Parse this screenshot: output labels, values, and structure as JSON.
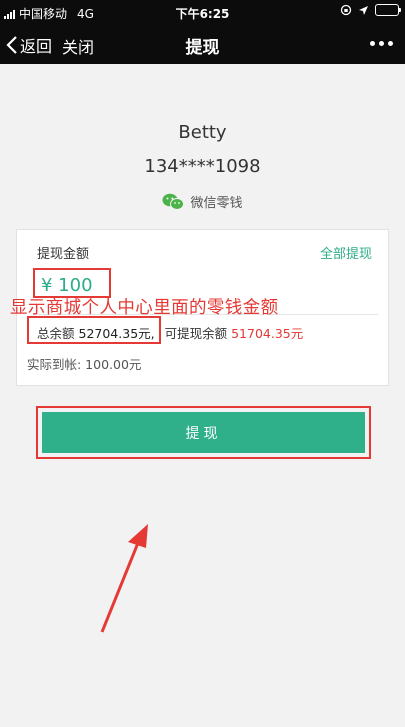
{
  "status_bar": {
    "carrier": "中国移动",
    "network": "4G",
    "time": "下午6:25"
  },
  "nav": {
    "back_label": "返回",
    "close_label": "关闭",
    "title": "提现"
  },
  "account": {
    "name": "Betty",
    "phone": "134****1098",
    "wallet_label": "微信零钱"
  },
  "card": {
    "amount_label": "提现金额",
    "withdraw_all": "全部提现",
    "amount_value": "¥ 100",
    "total_balance_label": "总余额",
    "total_balance_value": "52704.35元,",
    "available_label": "可提现余额",
    "available_value": "51704.35元",
    "arrival_text": "实际到帐: 100.00元"
  },
  "annotation": "显示商城个人中心里面的零钱金额",
  "submit_label": "提现",
  "colors": {
    "accent": "#2fb08b",
    "highlight": "#e53935"
  }
}
